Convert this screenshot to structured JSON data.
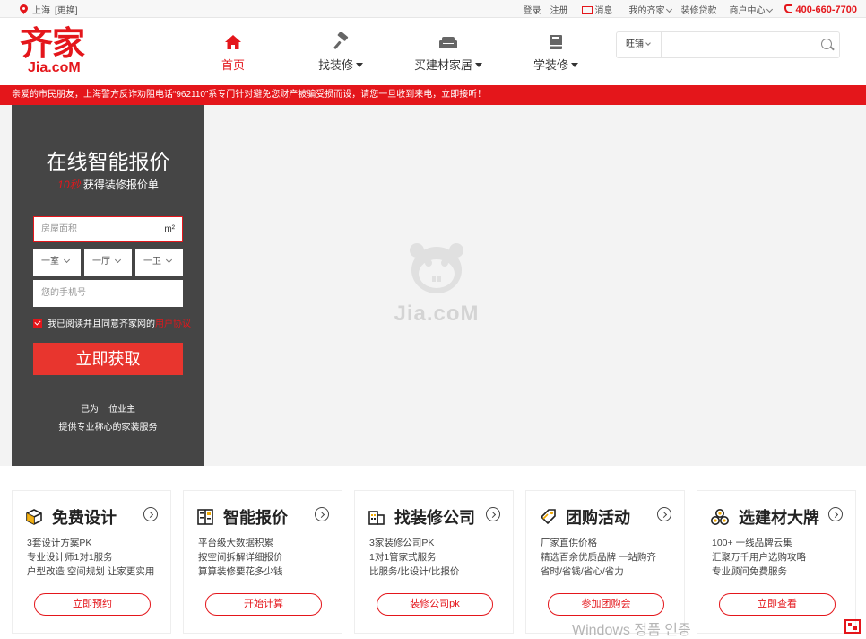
{
  "topbar": {
    "city": "上海",
    "switch_city": "[更换]",
    "login": "登录",
    "register": "注册",
    "messages": "消息",
    "my_account": "我的齐家",
    "loan": "装修贷款",
    "merchant_center": "商户中心",
    "hotline": "400-660-7700"
  },
  "header": {
    "logo_cn": "齐家",
    "logo_en": "Jia.coM",
    "nav": [
      {
        "label": "首页"
      },
      {
        "label": "找装修"
      },
      {
        "label": "买建材家居"
      },
      {
        "label": "学装修"
      }
    ],
    "search": {
      "scope": "旺铺",
      "placeholder": ""
    }
  },
  "notice": "亲爱的市民朋友，上海警方反诈劝阻电话“962110”系专门针对避免您财产被骗受损而设，请您一旦收到来电，立即接听！",
  "quote": {
    "title": "在线智能报价",
    "sub_highlight": "10秒",
    "sub_rest": "获得装修报价单",
    "area_placeholder": "房屋面积",
    "area_unit": "m²",
    "rooms": "一室",
    "halls": "一厅",
    "baths": "一卫",
    "mobile_placeholder": "您的手机号",
    "agree_text": "我已阅读并且同意齐家网的",
    "agree_link": "用户协议",
    "submit": "立即获取",
    "stat_prefix": "已为",
    "stat_suffix": "位业主",
    "stat_line2": "提供专业称心的家装服务"
  },
  "watermark": "Jia.coM",
  "cards": [
    {
      "title": "免费设计",
      "lines": [
        "3套设计方案PK",
        "专业设计师1对1服务",
        "户型改造 空间规划 让家更实用"
      ],
      "button": "立即预约"
    },
    {
      "title": "智能报价",
      "lines": [
        "平台级大数据积累",
        "按空间拆解详细报价",
        "算算装修要花多少钱"
      ],
      "button": "开始计算"
    },
    {
      "title": "找装修公司",
      "lines": [
        "3家装修公司PK",
        "1对1管家式服务",
        "比服务/比设计/比报价"
      ],
      "button": "装修公司pk"
    },
    {
      "title": "团购活动",
      "lines": [
        "厂家直供价格",
        "精选百余优质品牌 一站购齐",
        "省时/省钱/省心/省力"
      ],
      "button": "参加团购会"
    },
    {
      "title": "选建材大牌",
      "lines": [
        "100+ 一线品牌云集",
        "汇聚万千用户选购攻略",
        "专业顾问免费服务"
      ],
      "button": "立即查看"
    }
  ],
  "windows_watermark": "Windows 정품 인증"
}
